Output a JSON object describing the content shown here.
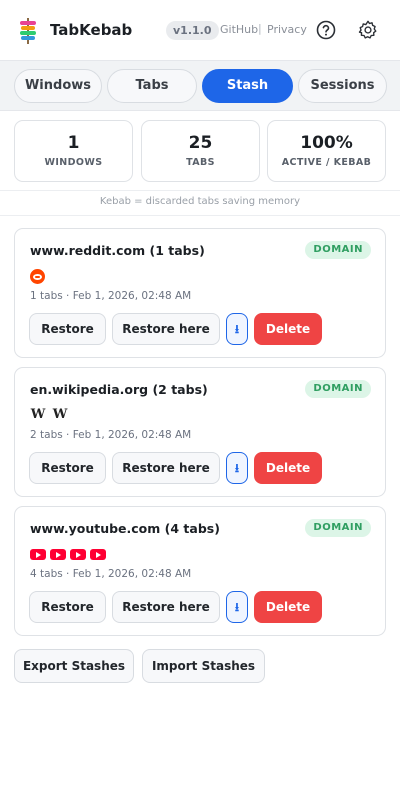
{
  "header": {
    "title": "TabKebab",
    "version": "v1.1.0",
    "links": [
      "GitHub",
      "Privacy"
    ],
    "link_separator": "|",
    "help_icon": "help-circle-icon",
    "settings_icon": "gear-icon"
  },
  "tabs": [
    {
      "label": "Windows",
      "active": false
    },
    {
      "label": "Tabs",
      "active": false
    },
    {
      "label": "Stash",
      "active": true
    },
    {
      "label": "Sessions",
      "active": false
    }
  ],
  "stats": [
    {
      "value": "1",
      "label": "WINDOWS"
    },
    {
      "value": "25",
      "label": "TABS"
    },
    {
      "value": "100%",
      "label": "ACTIVE / KEBAB"
    }
  ],
  "hint": "Kebab = discarded tabs saving memory",
  "stashes": [
    {
      "title": "www.reddit.com (1 tabs)",
      "badge": "DOMAIN",
      "favicons": [
        "reddit-icon"
      ],
      "meta": "1 tabs · Feb 1, 2026, 02:48 AM",
      "restore_label": "Restore",
      "restore_here_label": "Restore here",
      "download_label": "⭳",
      "delete_label": "Delete"
    },
    {
      "title": "en.wikipedia.org (2 tabs)",
      "badge": "DOMAIN",
      "favicons": [
        "wikipedia-icon",
        "wikipedia-icon"
      ],
      "meta": "2 tabs · Feb 1, 2026, 02:48 AM",
      "restore_label": "Restore",
      "restore_here_label": "Restore here",
      "download_label": "⭳",
      "delete_label": "Delete"
    },
    {
      "title": "www.youtube.com (4 tabs)",
      "badge": "DOMAIN",
      "favicons": [
        "youtube-icon",
        "youtube-icon",
        "youtube-icon",
        "youtube-icon"
      ],
      "meta": "4 tabs · Feb 1, 2026, 02:48 AM",
      "restore_label": "Restore",
      "restore_here_label": "Restore here",
      "download_label": "⭳",
      "delete_label": "Delete"
    }
  ],
  "footer": {
    "export_label": "Export Stashes",
    "import_label": "Import Stashes"
  },
  "colors": {
    "accent": "#1e66e8",
    "danger": "#ef4444",
    "domain_badge_bg": "#dcf5e7",
    "domain_badge_text": "#2f9e61"
  }
}
